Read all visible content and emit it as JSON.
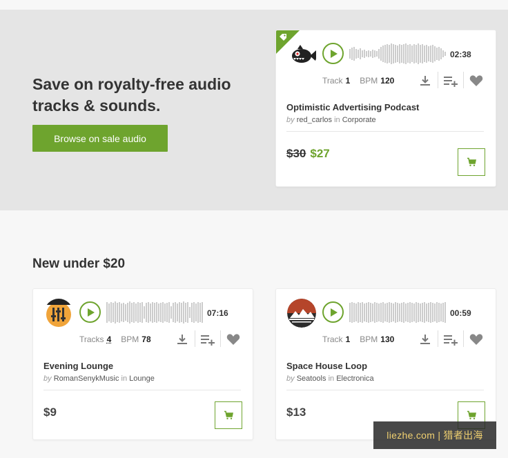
{
  "hero": {
    "title": "Save on royalty-free audio tracks & sounds.",
    "button_label": "Browse on sale audio"
  },
  "section": {
    "title": "New under $20"
  },
  "colors": {
    "accent": "#6ea42e",
    "hero_bg": "#e5e5e5",
    "waveform": "#cccccc"
  },
  "featured": {
    "duration": "02:38",
    "track_label": "Track",
    "track_count": "1",
    "bpm_label": "BPM",
    "bpm": "120",
    "title": "Optimistic Advertising Podcast",
    "by": "by",
    "author": "red_carlos",
    "in": "in",
    "category": "Corporate",
    "old_price": "$30",
    "price": "$27",
    "icons": [
      "sale-tag-icon",
      "play-icon",
      "download-icon",
      "add-to-playlist-icon",
      "heart-icon",
      "cart-icon"
    ]
  },
  "items": [
    {
      "duration": "07:16",
      "track_label": "Tracks",
      "track_count": "4",
      "bpm_label": "BPM",
      "bpm": "78",
      "title": "Evening Lounge",
      "by": "by",
      "author": "RomanSenykMusic",
      "in": "in",
      "category": "Lounge",
      "price": "$9"
    },
    {
      "duration": "00:59",
      "track_label": "Track",
      "track_count": "1",
      "bpm_label": "BPM",
      "bpm": "130",
      "title": "Space House Loop",
      "by": "by",
      "author": "Seatools",
      "in": "in",
      "category": "Electronica",
      "price": "$13"
    }
  ],
  "watermark": "liezhe.com | 猎者出海"
}
